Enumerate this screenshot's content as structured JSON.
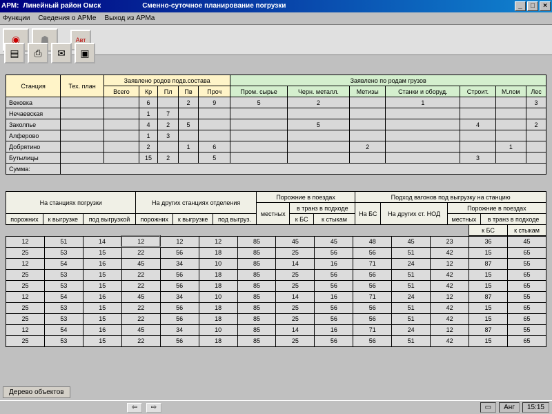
{
  "titlebar": {
    "prefix": "АРМ:",
    "region": "Линейный район Омск",
    "title": "Сменно-суточное планирование погрузки"
  },
  "winbtns": {
    "min": "_",
    "max": "□",
    "close": "×"
  },
  "menu": {
    "functions": "Функции",
    "about": "Сведения о АРМе",
    "exit": "Выход из АРМа"
  },
  "toolbar": {
    "avt_label": "Авт"
  },
  "tbl1": {
    "col_station": "Станция",
    "col_plan": "Тех. план",
    "grp_declared": "Заявлено родов подв.состава",
    "grp_cargo": "Заявлено по родам грузов",
    "c_total": "Всего",
    "c_kr": "Кр",
    "c_pl": "Пл",
    "c_pv": "Пв",
    "c_proch": "Проч",
    "c_prom": "Пром. сырье",
    "c_chern": "Черн. металл.",
    "c_met": "Метизы",
    "c_stanki": "Станки и оборуд.",
    "c_stroit": "Строит.",
    "c_mlom": "М.лом",
    "c_les": "Лес",
    "rows": [
      {
        "name": "Вековка",
        "kr": "6",
        "pl": "",
        "pv": "2",
        "proch": "9",
        "prom": "5",
        "chern": "2",
        "met": "",
        "stanki": "1",
        "stroit": "",
        "mlom": "",
        "les": "3"
      },
      {
        "name": "Нечаевская",
        "kr": "1",
        "pl": "7",
        "pv": "",
        "proch": "",
        "prom": "",
        "chern": "",
        "met": "",
        "stanki": "",
        "stroit": "",
        "mlom": "",
        "les": ""
      },
      {
        "name": "Заколпье",
        "kr": "4",
        "pl": "2",
        "pv": "5",
        "proch": "",
        "prom": "",
        "chern": "5",
        "met": "",
        "stanki": "",
        "stroit": "4",
        "mlom": "",
        "les": "2"
      },
      {
        "name": "Алферово",
        "kr": "1",
        "pl": "3",
        "pv": "",
        "proch": "",
        "prom": "",
        "chern": "",
        "met": "",
        "stanki": "",
        "stroit": "",
        "mlom": "",
        "les": ""
      },
      {
        "name": "Добрятино",
        "kr": "2",
        "pl": "",
        "pv": "1",
        "proch": "6",
        "prom": "",
        "chern": "",
        "met": "2",
        "stanki": "",
        "stroit": "",
        "mlom": "1",
        "les": ""
      },
      {
        "name": "Бутылицы",
        "kr": "15",
        "pl": "2",
        "pv": "",
        "proch": "5",
        "prom": "",
        "chern": "",
        "met": "",
        "stanki": "",
        "stroit": "3",
        "mlom": "",
        "les": ""
      }
    ],
    "sum_label": "Сумма:"
  },
  "tbl2": {
    "h_station_load": "На станциях погрузки",
    "h_other_station": "На других станциях отделения",
    "h_empty_train": "Порожние в поездах",
    "h_arrival": "Подход вагонов под выгрузку на станцию",
    "h_poroj": "порожних",
    "h_vygr": "к выгрузке",
    "h_podvygr": "под выгрузкой",
    "h_podvygr2": "под выгруз.",
    "h_local": "местных",
    "h_trans": "в транз в подходе",
    "h_kbs": "к БС",
    "h_kstyk": "к стыкам",
    "h_nabs": "На БС",
    "h_nanod": "На других ст. НОД",
    "h_empty_train2": "Порожние в поездах",
    "h_trans2": "в транз в подходе",
    "rows": [
      [
        "12",
        "51",
        "14",
        "12",
        "12",
        "12",
        "85",
        "45",
        "45",
        "48",
        "45",
        "23",
        "36",
        "45"
      ],
      [
        "25",
        "53",
        "15",
        "22",
        "56",
        "18",
        "85",
        "25",
        "56",
        "56",
        "51",
        "42",
        "15",
        "65"
      ],
      [
        "12",
        "54",
        "16",
        "45",
        "34",
        "10",
        "85",
        "14",
        "16",
        "71",
        "24",
        "12",
        "87",
        "55"
      ],
      [
        "25",
        "53",
        "15",
        "22",
        "56",
        "18",
        "85",
        "25",
        "56",
        "56",
        "51",
        "42",
        "15",
        "65"
      ],
      [
        "25",
        "53",
        "15",
        "22",
        "56",
        "18",
        "85",
        "25",
        "56",
        "56",
        "51",
        "42",
        "15",
        "65"
      ],
      [
        "12",
        "54",
        "16",
        "45",
        "34",
        "10",
        "85",
        "14",
        "16",
        "71",
        "24",
        "12",
        "87",
        "55"
      ],
      [
        "25",
        "53",
        "15",
        "22",
        "56",
        "18",
        "85",
        "25",
        "56",
        "56",
        "51",
        "42",
        "15",
        "65"
      ],
      [
        "25",
        "53",
        "15",
        "22",
        "56",
        "18",
        "85",
        "25",
        "56",
        "56",
        "51",
        "42",
        "15",
        "65"
      ],
      [
        "12",
        "54",
        "16",
        "45",
        "34",
        "10",
        "85",
        "14",
        "16",
        "71",
        "24",
        "12",
        "87",
        "55"
      ],
      [
        "25",
        "53",
        "15",
        "22",
        "56",
        "18",
        "85",
        "25",
        "56",
        "56",
        "51",
        "42",
        "15",
        "65"
      ]
    ]
  },
  "footer": {
    "tab1": "Дерево объектов"
  },
  "status": {
    "lang": "Анг",
    "time": "15:15"
  }
}
